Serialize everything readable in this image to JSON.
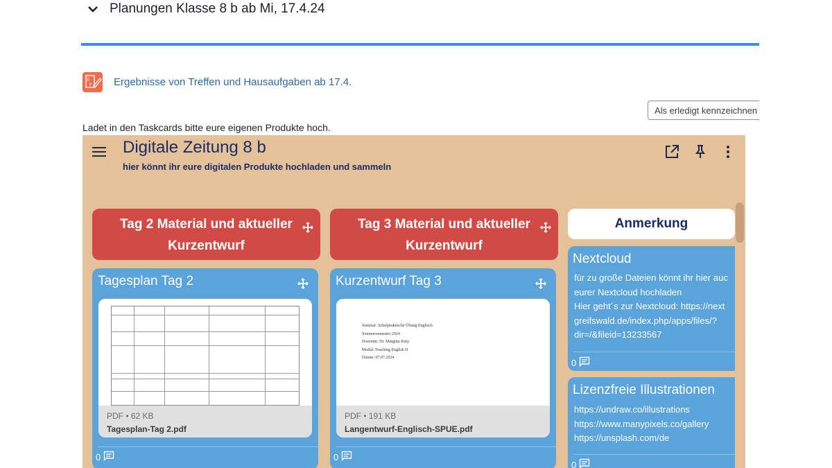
{
  "section": {
    "title": "Planungen Klasse 8 b ab Mi, 17.4.24"
  },
  "activity": {
    "link": "Ergebnisse von Treffen und Hausaufgaben ab 17.4.",
    "icon": "epub-icon"
  },
  "done_button": {
    "label": "Als erledigt kennzeichnen"
  },
  "intro": "Ladet in den Taskcards bitte eure eigenen Produkte hoch.",
  "board": {
    "title": "Digitale Zeitung 8 b",
    "subtitle": "hier könnt ihr eure digitalen Produkte hochladen und sammeln",
    "colors": {
      "background": "#e5c199",
      "column_header": "#d24a45",
      "card": "#5aa3db",
      "title": "#1a2b66"
    },
    "columns": [
      {
        "header": "Tag 2 Material und aktueller Kurzentwurf",
        "card": {
          "title": "Tagesplan Tag 2",
          "file_size": "PDF • 62 KB",
          "file_name": "Tagesplan-Tag 2.pdf",
          "comments": "0"
        }
      },
      {
        "header": "Tag 3 Material und aktueller Kurzentwurf",
        "card": {
          "title": "Kurzentwurf Tag 3",
          "file_size": "PDF • 191 KB",
          "file_name": "Langentwurf-Englisch-SPUE.pdf",
          "comments": "0",
          "doc_lines": [
            "Seminar: Schulpraktische Übung Englisch",
            "Sommersemester 2024",
            "Dozentin: Dr. Margitta Kuty",
            "Modul: Teaching English II",
            "Datum: 07.07.2024"
          ]
        }
      },
      {
        "header": "Anmerkung",
        "cards": [
          {
            "title": "Nextcloud",
            "text": "für zu große Dateien könnt ihr hier auc\neurer Nextcloud hochladen\nHier geht´s zur Nextcloud: https://next\ngreifswald.de/index.php/apps/files/?\ndir=/&fileid=13233567",
            "comments": "0"
          },
          {
            "title": "Lizenzfreie Illustrationen",
            "text": "https://undraw.co/illustrations\nhttps://www.manypixels.co/gallery\nhttps://unsplash.com/de",
            "comments": "0"
          }
        ]
      }
    ]
  }
}
